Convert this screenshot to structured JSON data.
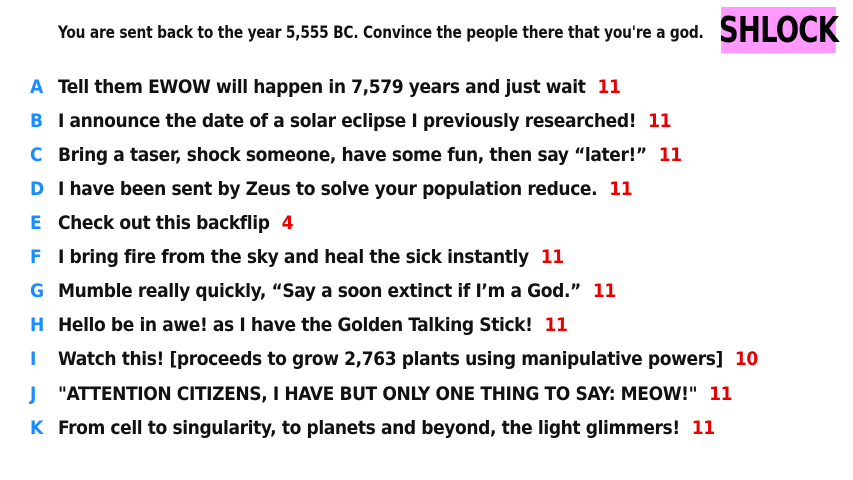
{
  "prompt": "You are sent back to the year 5,555 BC. Convince the people there that you're a god.",
  "badge": "SHLOCK",
  "colors": {
    "letter": "#1a8cff",
    "score": "#e60000",
    "badge_bg": "#ff99ff"
  },
  "answers": [
    {
      "letter": "A",
      "text": "Tell them EWOW will happen in 7,579 years and just wait",
      "score": "11"
    },
    {
      "letter": "B",
      "text": "I announce the date of a solar eclipse I previously researched!",
      "score": "11"
    },
    {
      "letter": "C",
      "text": "Bring a taser, shock someone, have some fun, then say “later!”",
      "score": "11"
    },
    {
      "letter": "D",
      "text": "I have been sent by Zeus to solve your population reduce.",
      "score": "11"
    },
    {
      "letter": "E",
      "text": "Check out this backflip",
      "score": "4"
    },
    {
      "letter": "F",
      "text": "I bring fire from the sky and heal the sick instantly",
      "score": "11"
    },
    {
      "letter": "G",
      "text": "Mumble really quickly, “Say a soon extinct if I’m a God.”",
      "score": "11"
    },
    {
      "letter": "H",
      "text": "Hello be in awe! as I have the Golden Talking Stick!",
      "score": "11"
    },
    {
      "letter": "I",
      "text": "Watch this! [proceeds to grow 2,763 plants using manipulative powers]",
      "score": "10"
    },
    {
      "letter": "J",
      "text": "\"ATTENTION CITIZENS, I HAVE BUT ONLY ONE THING TO SAY: MEOW!\"",
      "score": "11"
    },
    {
      "letter": "K",
      "text": "From cell to singularity, to planets and beyond, the light glimmers!",
      "score": "11"
    }
  ]
}
